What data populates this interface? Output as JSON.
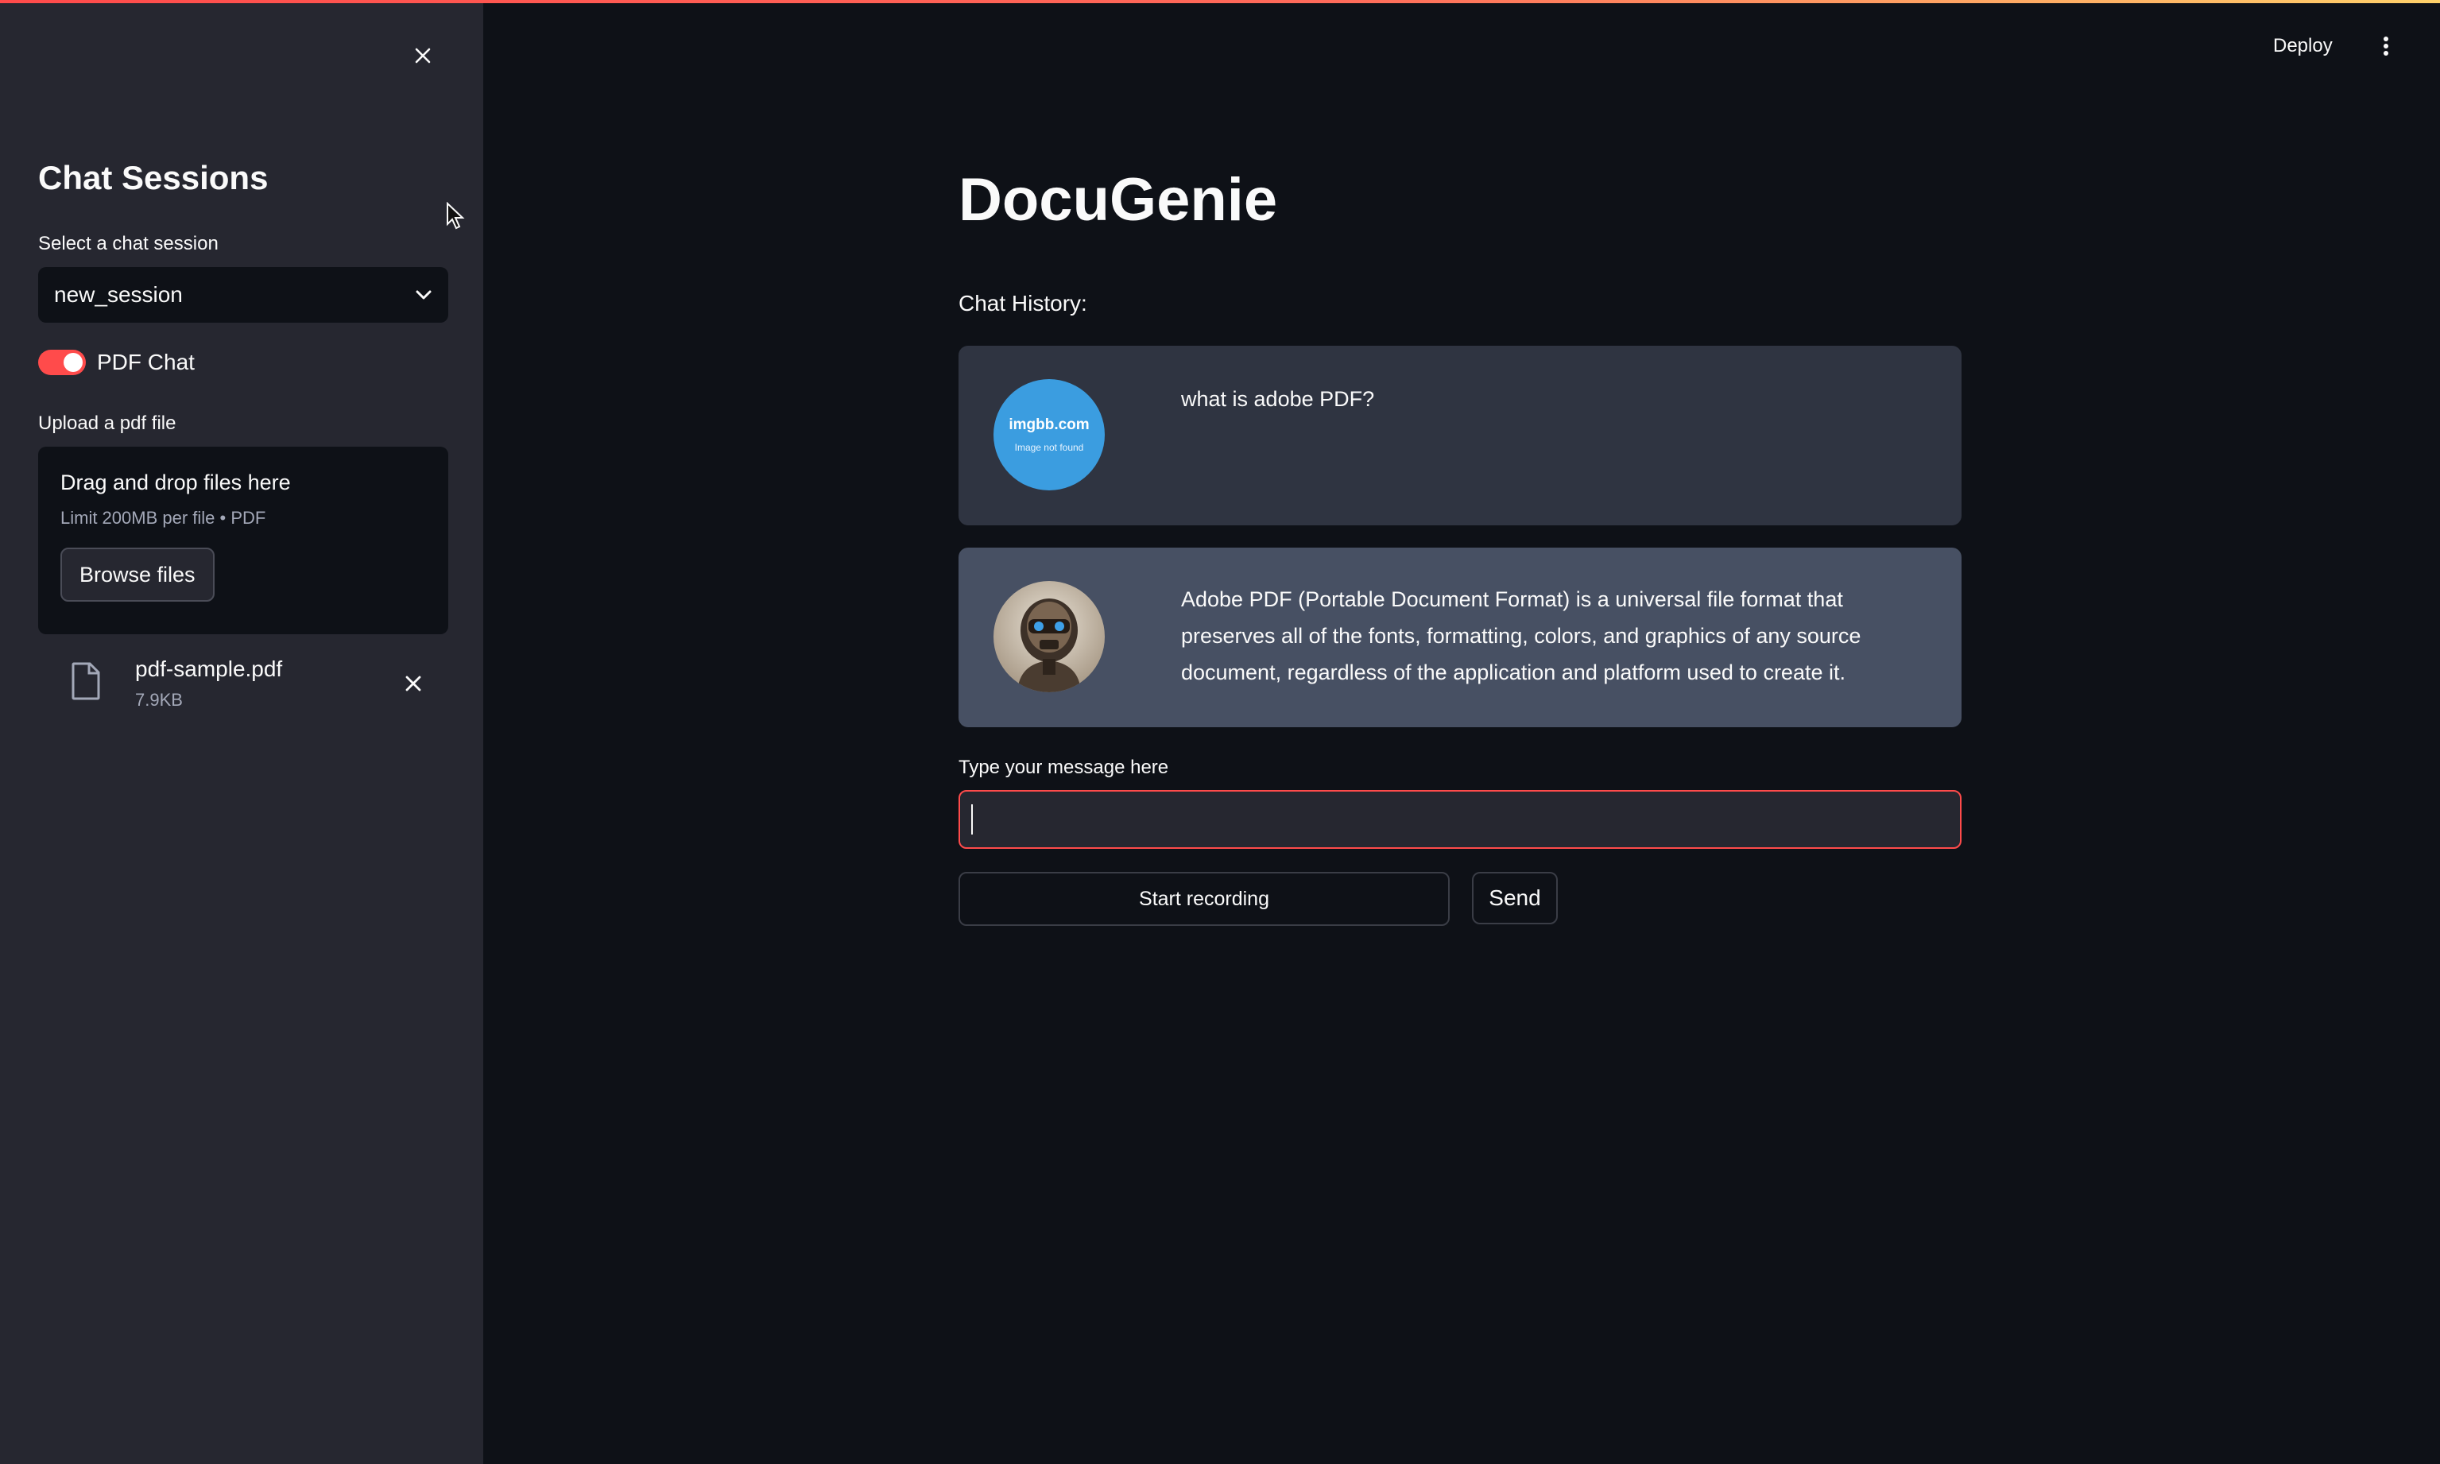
{
  "sidebar": {
    "title": "Chat Sessions",
    "session_label": "Select a chat session",
    "session_value": "new_session",
    "toggle_label": "PDF Chat",
    "toggle_on": true,
    "upload_label": "Upload a pdf file",
    "dropzone_title": "Drag and drop files here",
    "dropzone_limit": "Limit 200MB per file • PDF",
    "browse_label": "Browse files",
    "file": {
      "name": "pdf-sample.pdf",
      "size": "7.9KB"
    }
  },
  "header": {
    "deploy_label": "Deploy"
  },
  "main": {
    "title": "DocuGenie",
    "history_label": "Chat History:",
    "messages": [
      {
        "role": "user",
        "avatar_text": "imgbb.com",
        "avatar_subtext": "Image not found",
        "text": "what is adobe PDF?"
      },
      {
        "role": "assistant",
        "text": "Adobe PDF (Portable Document Format) is a universal file format that preserves all of the fonts, formatting, colors, and graphics of any source document, regardless of the application and platform used to create it."
      }
    ],
    "input_label": "Type your message here",
    "input_value": "",
    "record_label": "Start recording",
    "send_label": "Send"
  },
  "colors": {
    "accent": "#ff4b4b",
    "sidebar_bg": "#262730",
    "main_bg": "#0e1117",
    "user_msg_bg": "#2f3441",
    "bot_msg_bg": "#475063",
    "user_avatar_bg": "#3b9de0"
  }
}
